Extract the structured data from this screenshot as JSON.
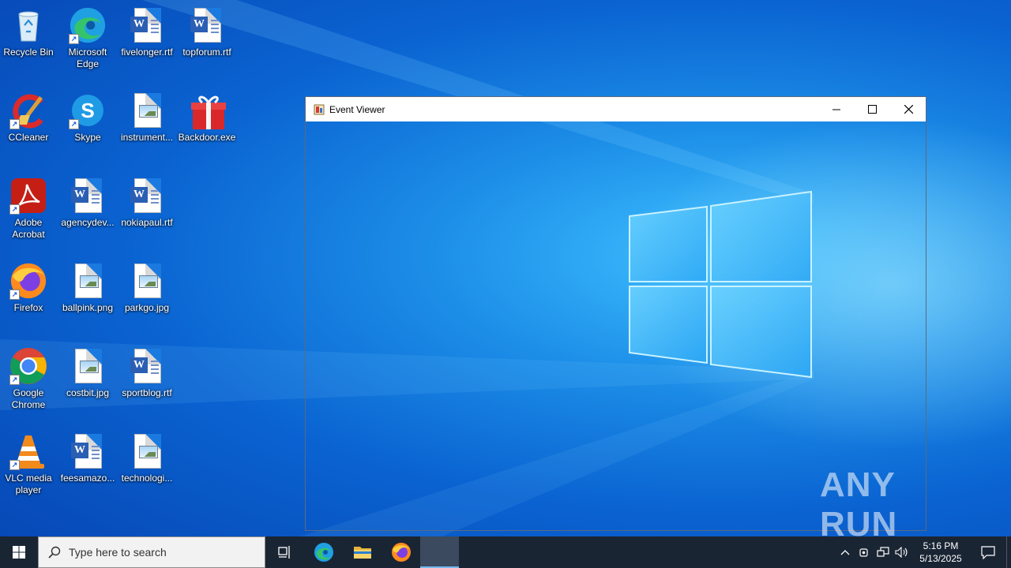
{
  "desktop": {
    "icons": [
      {
        "label": "Recycle Bin",
        "icon": "recycle-bin-icon"
      },
      {
        "label": "Microsoft Edge",
        "icon": "edge-icon"
      },
      {
        "label": "fivelonger.rtf",
        "icon": "word-doc-icon"
      },
      {
        "label": "topforum.rtf",
        "icon": "word-doc-icon"
      },
      {
        "label": "CCleaner",
        "icon": "ccleaner-icon"
      },
      {
        "label": "Skype",
        "icon": "skype-icon"
      },
      {
        "label": "instrument...",
        "icon": "image-file-icon"
      },
      {
        "label": "Backdoor.exe",
        "icon": "gift-box-icon"
      },
      {
        "label": "Adobe Acrobat",
        "icon": "acrobat-icon"
      },
      {
        "label": "agencydev...",
        "icon": "word-doc-icon"
      },
      {
        "label": "nokiapaul.rtf",
        "icon": "word-doc-icon"
      },
      {
        "label": "Firefox",
        "icon": "firefox-icon"
      },
      {
        "label": "ballpink.png",
        "icon": "image-file-icon"
      },
      {
        "label": "parkgo.jpg",
        "icon": "image-file-icon"
      },
      {
        "label": "Google Chrome",
        "icon": "chrome-icon"
      },
      {
        "label": "costbit.jpg",
        "icon": "image-file-icon"
      },
      {
        "label": "sportblog.rtf",
        "icon": "word-doc-icon"
      },
      {
        "label": "VLC media player",
        "icon": "vlc-icon"
      },
      {
        "label": "feesamazo...",
        "icon": "word-doc-icon"
      },
      {
        "label": "technologi...",
        "icon": "image-file-icon"
      }
    ]
  },
  "window": {
    "title": "Event Viewer",
    "buttons": {
      "minimize": "minimize-icon",
      "maximize": "maximize-icon",
      "close": "close-icon"
    }
  },
  "taskbar": {
    "search_placeholder": "Type here to search",
    "pinned": [
      "task-view-icon",
      "edge-icon",
      "file-explorer-icon",
      "firefox-icon",
      "event-viewer-task"
    ],
    "clock": {
      "time": "5:16 PM",
      "date": "5/13/2025"
    }
  },
  "watermark": "ANY RUN",
  "colors": {
    "desktop_accent": "#0a63d1",
    "taskbar_bg": "#1a2534",
    "active_task_indicator": "#76b9ed"
  }
}
